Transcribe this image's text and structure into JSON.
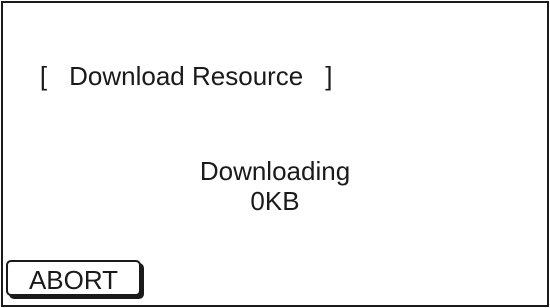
{
  "window": {
    "title_open_bracket": "[",
    "title": "Download Resource",
    "title_close_bracket": "]"
  },
  "status": {
    "line1": "Downloading",
    "line2": "0KB"
  },
  "buttons": {
    "abort_label": "ABORT"
  },
  "colors": {
    "foreground": "#1a1a1a",
    "background": "#ffffff"
  }
}
